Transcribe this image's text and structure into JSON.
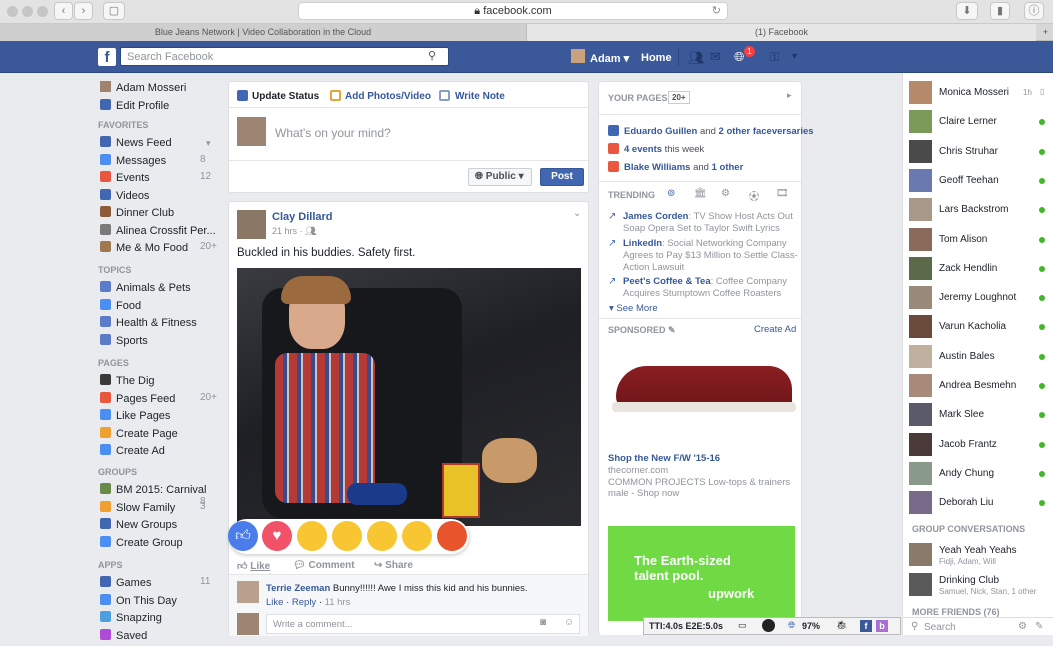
{
  "browser": {
    "url": "facebook.com",
    "tabs": [
      "Blue Jeans Network | Video Collaboration in the Cloud",
      "(1) Facebook"
    ]
  },
  "topbar": {
    "search_placeholder": "Search Facebook",
    "user": "Adam",
    "home": "Home",
    "notification_count": "1"
  },
  "left": {
    "profile": "Adam Mosseri",
    "edit_profile": "Edit Profile",
    "favorites_head": "FAVORITES",
    "favorites": [
      {
        "label": "News Feed",
        "count": ""
      },
      {
        "label": "Messages",
        "count": "8"
      },
      {
        "label": "Events",
        "count": "12"
      },
      {
        "label": "Videos",
        "count": ""
      },
      {
        "label": "Dinner Club",
        "count": ""
      },
      {
        "label": "Alinea Crossfit Per...",
        "count": ""
      },
      {
        "label": "Me & Mo Food",
        "count": "20+"
      }
    ],
    "topics_head": "TOPICS",
    "topics": [
      "Animals & Pets",
      "Food",
      "Health & Fitness",
      "Sports"
    ],
    "pages_head": "PAGES",
    "pages": [
      {
        "label": "The Dig",
        "count": ""
      },
      {
        "label": "Pages Feed",
        "count": "20+"
      },
      {
        "label": "Like Pages",
        "count": ""
      },
      {
        "label": "Create Page",
        "count": ""
      },
      {
        "label": "Create Ad",
        "count": ""
      }
    ],
    "groups_head": "GROUPS",
    "groups": [
      {
        "label": "BM 2015: Carnival ...",
        "count": "8"
      },
      {
        "label": "Slow Family",
        "count": "3"
      },
      {
        "label": "New Groups",
        "count": ""
      },
      {
        "label": "Create Group",
        "count": ""
      }
    ],
    "apps_head": "APPS",
    "apps": [
      {
        "label": "Games",
        "count": "11"
      },
      {
        "label": "On This Day",
        "count": ""
      },
      {
        "label": "Snapzing",
        "count": ""
      },
      {
        "label": "Saved",
        "count": ""
      }
    ]
  },
  "composer": {
    "update_status": "Update Status",
    "add_photos": "Add Photos/Video",
    "write_note": "Write Note",
    "placeholder": "What's on your mind?",
    "privacy": "Public",
    "post": "Post"
  },
  "post": {
    "author": "Clay Dillard",
    "time": "21 hrs",
    "text": "Buckled in his buddies. Safety first.",
    "like": "Like",
    "comment": "Comment",
    "share": "Share",
    "comment_author": "Terrie Zeeman",
    "comment_text": "Bunny!!!!!! Awe I miss this kid and his bunnies.",
    "comment_like": "Like",
    "comment_reply": "Reply",
    "comment_time": "11 hrs",
    "write_comment": "Write a comment..."
  },
  "rightcol": {
    "your_pages": "YOUR PAGES",
    "pages_count": "20+",
    "notifs": [
      {
        "bold": "Eduardo Guillen",
        "rest": " and ",
        "bold2": "2 other faceversaries"
      },
      {
        "bold": "4 events",
        "rest": " this week",
        "bold2": ""
      },
      {
        "bold": "Blake Williams",
        "rest": " and ",
        "bold2": "1 other"
      }
    ],
    "trending": "TRENDING",
    "trends": [
      {
        "name": "James Corden",
        "text": ": TV Show Host Acts Out Soap Opera Set to Taylor Swift Lyrics"
      },
      {
        "name": "LinkedIn",
        "text": ": Social Networking Company Agrees to Pay $13 Million to Settle Class-Action Lawsuit"
      },
      {
        "name": "Peet's Coffee & Tea",
        "text": ": Coffee Company Acquires Stumptown Coffee Roasters"
      }
    ],
    "see_more": "See More",
    "sponsored": "SPONSORED",
    "create_ad": "Create Ad",
    "ad_title": "Shop the New F/W '15-16",
    "ad_site": "thecorner.com",
    "ad_text": "COMMON PROJECTS Low-tops & trainers male - Shop now",
    "ad2_line1": "The Earth-sized",
    "ad2_line2": "talent pool.",
    "ad2_brand": "upwork"
  },
  "chat": {
    "people": [
      {
        "name": "Monica Mosseri",
        "status": "1h"
      },
      {
        "name": "Claire Lerner",
        "status": "on"
      },
      {
        "name": "Chris Struhar",
        "status": "on"
      },
      {
        "name": "Geoff Teehan",
        "status": "on"
      },
      {
        "name": "Lars Backstrom",
        "status": "on"
      },
      {
        "name": "Tom Alison",
        "status": "on"
      },
      {
        "name": "Zack Hendlin",
        "status": "on"
      },
      {
        "name": "Jeremy Loughnot",
        "status": "on"
      },
      {
        "name": "Varun Kacholia",
        "status": "on"
      },
      {
        "name": "Austin Bales",
        "status": "on"
      },
      {
        "name": "Andrea Besmehn",
        "status": "on"
      },
      {
        "name": "Mark Slee",
        "status": "on"
      },
      {
        "name": "Jacob Frantz",
        "status": "on"
      },
      {
        "name": "Andy Chung",
        "status": "on"
      },
      {
        "name": "Deborah Liu",
        "status": "on"
      }
    ],
    "group_head": "GROUP CONVERSATIONS",
    "groups": [
      {
        "name": "Yeah Yeah Yeahs",
        "sub": "Fidji, Adam, Will"
      },
      {
        "name": "Drinking Club",
        "sub": "Samuel, Nick, Stan, 1 other"
      }
    ],
    "more_friends": "MORE FRIENDS (76)",
    "search": "Search"
  },
  "devbar": {
    "timing": "TTI:4.0s E2E:5.0s",
    "pct": "97%"
  },
  "colors": {
    "fb_blue": "#3b5998",
    "link": "#365899",
    "online": "#42b72a"
  }
}
